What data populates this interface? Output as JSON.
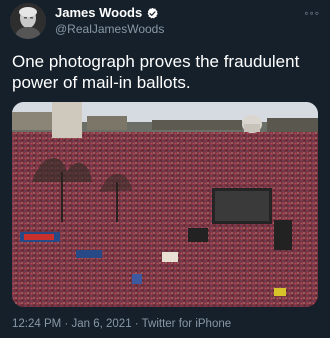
{
  "author": {
    "display_name": "James Woods",
    "handle": "@RealJamesWoods",
    "verified_icon": "verified-badge-icon"
  },
  "more_label": "◦◦◦",
  "tweet": {
    "text": "One photograph proves the fraudulent power of mail-in ballots."
  },
  "media": {
    "type": "photo",
    "icon": "crowd-photo"
  },
  "meta": {
    "time": "12:24 PM",
    "separator": "·",
    "date": "Jan 6, 2021",
    "source": "Twitter for iPhone"
  },
  "colors": {
    "background": "#15202b",
    "secondary_text": "#8899a6",
    "verified": "#1da1f2"
  }
}
